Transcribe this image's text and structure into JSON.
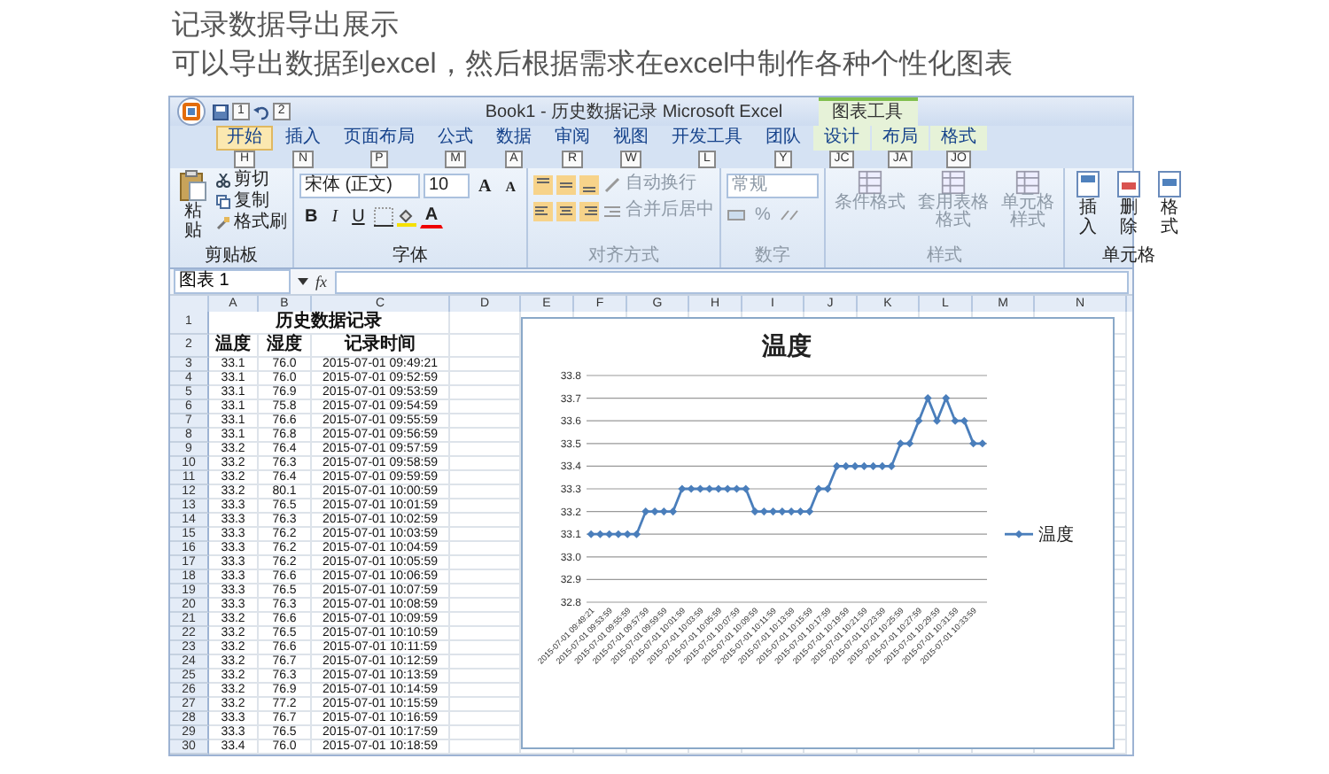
{
  "page": {
    "heading": "记录数据导出展示",
    "subheading": "可以导出数据到excel，然后根据需求在excel中制作各种个性化图表"
  },
  "excel": {
    "title": "Book1 - 历史数据记录 Microsoft Excel",
    "quick_access_keytips": [
      "1",
      "2"
    ],
    "context_tab_group": "图表工具",
    "tabs": [
      {
        "label": "开始",
        "keytip": "H",
        "selected": true,
        "contextual": false
      },
      {
        "label": "插入",
        "keytip": "N",
        "selected": false,
        "contextual": false
      },
      {
        "label": "页面布局",
        "keytip": "P",
        "selected": false,
        "contextual": false
      },
      {
        "label": "公式",
        "keytip": "M",
        "selected": false,
        "contextual": false
      },
      {
        "label": "数据",
        "keytip": "A",
        "selected": false,
        "contextual": false
      },
      {
        "label": "审阅",
        "keytip": "R",
        "selected": false,
        "contextual": false
      },
      {
        "label": "视图",
        "keytip": "W",
        "selected": false,
        "contextual": false
      },
      {
        "label": "开发工具",
        "keytip": "L",
        "selected": false,
        "contextual": false
      },
      {
        "label": "团队",
        "keytip": "Y",
        "selected": false,
        "contextual": false
      },
      {
        "label": "设计",
        "keytip": "JC",
        "selected": false,
        "contextual": true
      },
      {
        "label": "布局",
        "keytip": "JA",
        "selected": false,
        "contextual": true
      },
      {
        "label": "格式",
        "keytip": "JO",
        "selected": false,
        "contextual": true
      }
    ],
    "ribbon": {
      "clipboard": {
        "label": "剪贴板",
        "disabled": false,
        "paste": "粘贴",
        "cut": "剪切",
        "copy": "复制",
        "format_painter": "格式刷"
      },
      "font": {
        "label": "字体",
        "disabled": false,
        "font_name": "宋体 (正文)",
        "font_size": "10",
        "grow": "A",
        "shrink": "A",
        "bold": "B",
        "italic": "I",
        "underline": "U",
        "font_color": "A"
      },
      "alignment": {
        "label": "对齐方式",
        "disabled": true,
        "wrap_text": "自动换行",
        "merge_center": "合并后居中"
      },
      "number": {
        "label": "数字",
        "disabled": true,
        "format": "常规",
        "percent": "%"
      },
      "styles": {
        "label": "样式",
        "disabled": true,
        "buttons": [
          "条件格式",
          "套用表格格式",
          "单元格样式"
        ]
      },
      "cells": {
        "label": "单元格",
        "disabled": false,
        "buttons": [
          "插入",
          "删除",
          "格式"
        ]
      }
    },
    "formula_bar": {
      "name_box": "图表 1",
      "function_label": "fx"
    },
    "sheet": {
      "columns": [
        "A",
        "B",
        "C",
        "D",
        "E",
        "F",
        "G",
        "H",
        "I",
        "J",
        "K",
        "L",
        "M",
        "N"
      ],
      "title_row": {
        "number": "1",
        "text": "历史数据记录"
      },
      "rows": [
        {
          "number": "2",
          "kind": "header",
          "cells": [
            "温度",
            "湿度",
            "记录时间"
          ]
        },
        {
          "number": "3",
          "kind": "data",
          "cells": [
            "33.1",
            "76.0",
            "2015-07-01 09:49:21"
          ]
        },
        {
          "number": "4",
          "kind": "data",
          "cells": [
            "33.1",
            "76.0",
            "2015-07-01 09:52:59"
          ]
        },
        {
          "number": "5",
          "kind": "data",
          "cells": [
            "33.1",
            "76.9",
            "2015-07-01 09:53:59"
          ]
        },
        {
          "number": "6",
          "kind": "data",
          "cells": [
            "33.1",
            "75.8",
            "2015-07-01 09:54:59"
          ]
        },
        {
          "number": "7",
          "kind": "data",
          "cells": [
            "33.1",
            "76.6",
            "2015-07-01 09:55:59"
          ]
        },
        {
          "number": "8",
          "kind": "data",
          "cells": [
            "33.1",
            "76.8",
            "2015-07-01 09:56:59"
          ]
        },
        {
          "number": "9",
          "kind": "data",
          "cells": [
            "33.2",
            "76.4",
            "2015-07-01 09:57:59"
          ]
        },
        {
          "number": "10",
          "kind": "data",
          "cells": [
            "33.2",
            "76.3",
            "2015-07-01 09:58:59"
          ]
        },
        {
          "number": "11",
          "kind": "data",
          "cells": [
            "33.2",
            "76.4",
            "2015-07-01 09:59:59"
          ]
        },
        {
          "number": "12",
          "kind": "data",
          "cells": [
            "33.2",
            "80.1",
            "2015-07-01 10:00:59"
          ]
        },
        {
          "number": "13",
          "kind": "data",
          "cells": [
            "33.3",
            "76.5",
            "2015-07-01 10:01:59"
          ]
        },
        {
          "number": "14",
          "kind": "data",
          "cells": [
            "33.3",
            "76.3",
            "2015-07-01 10:02:59"
          ]
        },
        {
          "number": "15",
          "kind": "data",
          "cells": [
            "33.3",
            "76.2",
            "2015-07-01 10:03:59"
          ]
        },
        {
          "number": "16",
          "kind": "data",
          "cells": [
            "33.3",
            "76.2",
            "2015-07-01 10:04:59"
          ]
        },
        {
          "number": "17",
          "kind": "data",
          "cells": [
            "33.3",
            "76.2",
            "2015-07-01 10:05:59"
          ]
        },
        {
          "number": "18",
          "kind": "data",
          "cells": [
            "33.3",
            "76.6",
            "2015-07-01 10:06:59"
          ]
        },
        {
          "number": "19",
          "kind": "data",
          "cells": [
            "33.3",
            "76.5",
            "2015-07-01 10:07:59"
          ]
        },
        {
          "number": "20",
          "kind": "data",
          "cells": [
            "33.3",
            "76.3",
            "2015-07-01 10:08:59"
          ]
        },
        {
          "number": "21",
          "kind": "data",
          "cells": [
            "33.2",
            "76.6",
            "2015-07-01 10:09:59"
          ]
        },
        {
          "number": "22",
          "kind": "data",
          "cells": [
            "33.2",
            "76.5",
            "2015-07-01 10:10:59"
          ]
        },
        {
          "number": "23",
          "kind": "data",
          "cells": [
            "33.2",
            "76.6",
            "2015-07-01 10:11:59"
          ]
        },
        {
          "number": "24",
          "kind": "data",
          "cells": [
            "33.2",
            "76.7",
            "2015-07-01 10:12:59"
          ]
        },
        {
          "number": "25",
          "kind": "data",
          "cells": [
            "33.2",
            "76.3",
            "2015-07-01 10:13:59"
          ]
        },
        {
          "number": "26",
          "kind": "data",
          "cells": [
            "33.2",
            "76.9",
            "2015-07-01 10:14:59"
          ]
        },
        {
          "number": "27",
          "kind": "data",
          "cells": [
            "33.2",
            "77.2",
            "2015-07-01 10:15:59"
          ]
        },
        {
          "number": "28",
          "kind": "data",
          "cells": [
            "33.3",
            "76.7",
            "2015-07-01 10:16:59"
          ]
        },
        {
          "number": "29",
          "kind": "data",
          "cells": [
            "33.3",
            "76.5",
            "2015-07-01 10:17:59"
          ]
        },
        {
          "number": "30",
          "kind": "data",
          "cells": [
            "33.4",
            "76.0",
            "2015-07-01 10:18:59"
          ]
        }
      ]
    },
    "chart": {
      "chart_data": {
        "type": "line",
        "title": "温度",
        "grid": true,
        "categories": [
          "2015-07-01 09:49:21",
          null,
          "2015-07-01 09:53:59",
          null,
          "2015-07-01 09:55:59",
          null,
          "2015-07-01 09:57:59",
          null,
          "2015-07-01 09:59:59",
          null,
          "2015-07-01 10:01:59",
          null,
          "2015-07-01 10:03:59",
          null,
          "2015-07-01 10:05:59",
          null,
          "2015-07-01 10:07:59",
          null,
          "2015-07-01 10:09:59",
          null,
          "2015-07-01 10:11:59",
          null,
          "2015-07-01 10:13:59",
          null,
          "2015-07-01 10:15:59",
          null,
          "2015-07-01 10:17:59",
          null,
          "2015-07-01 10:19:59",
          null,
          "2015-07-01 10:21:59",
          null,
          "2015-07-01 10:23:59",
          null,
          "2015-07-01 10:25:59",
          null,
          "2015-07-01 10:27:59",
          null,
          "2015-07-01 10:29:59",
          null,
          "2015-07-01 10:31:59",
          null,
          "2015-07-01 10:33:59",
          null
        ],
        "series": [
          {
            "name": "温度",
            "color": "#4a7ebb",
            "marker": "diamond",
            "values": [
              33.1,
              33.1,
              33.1,
              33.1,
              33.1,
              33.1,
              33.2,
              33.2,
              33.2,
              33.2,
              33.3,
              33.3,
              33.3,
              33.3,
              33.3,
              33.3,
              33.3,
              33.3,
              33.2,
              33.2,
              33.2,
              33.2,
              33.2,
              33.2,
              33.2,
              33.3,
              33.3,
              33.4,
              33.4,
              33.4,
              33.4,
              33.4,
              33.4,
              33.4,
              33.5,
              33.5,
              33.6,
              33.7,
              33.6,
              33.7,
              33.6,
              33.6,
              33.5,
              33.5
            ]
          }
        ],
        "ylim": [
          32.8,
          33.8
        ],
        "yticks": [
          {
            "value": 32.8,
            "label": "32.8"
          },
          {
            "value": 32.9,
            "label": "32.9"
          },
          {
            "value": 33.0,
            "label": "33.0"
          },
          {
            "value": 33.1,
            "label": "33.1"
          },
          {
            "value": 33.2,
            "label": "33.2"
          },
          {
            "value": 33.3,
            "label": "33.3"
          },
          {
            "value": 33.4,
            "label": "33.4"
          },
          {
            "value": 33.5,
            "label": "33.5"
          },
          {
            "value": 33.6,
            "label": "33.6"
          },
          {
            "value": 33.7,
            "label": "33.7"
          },
          {
            "value": 33.8,
            "label": "33.8"
          }
        ]
      }
    }
  }
}
